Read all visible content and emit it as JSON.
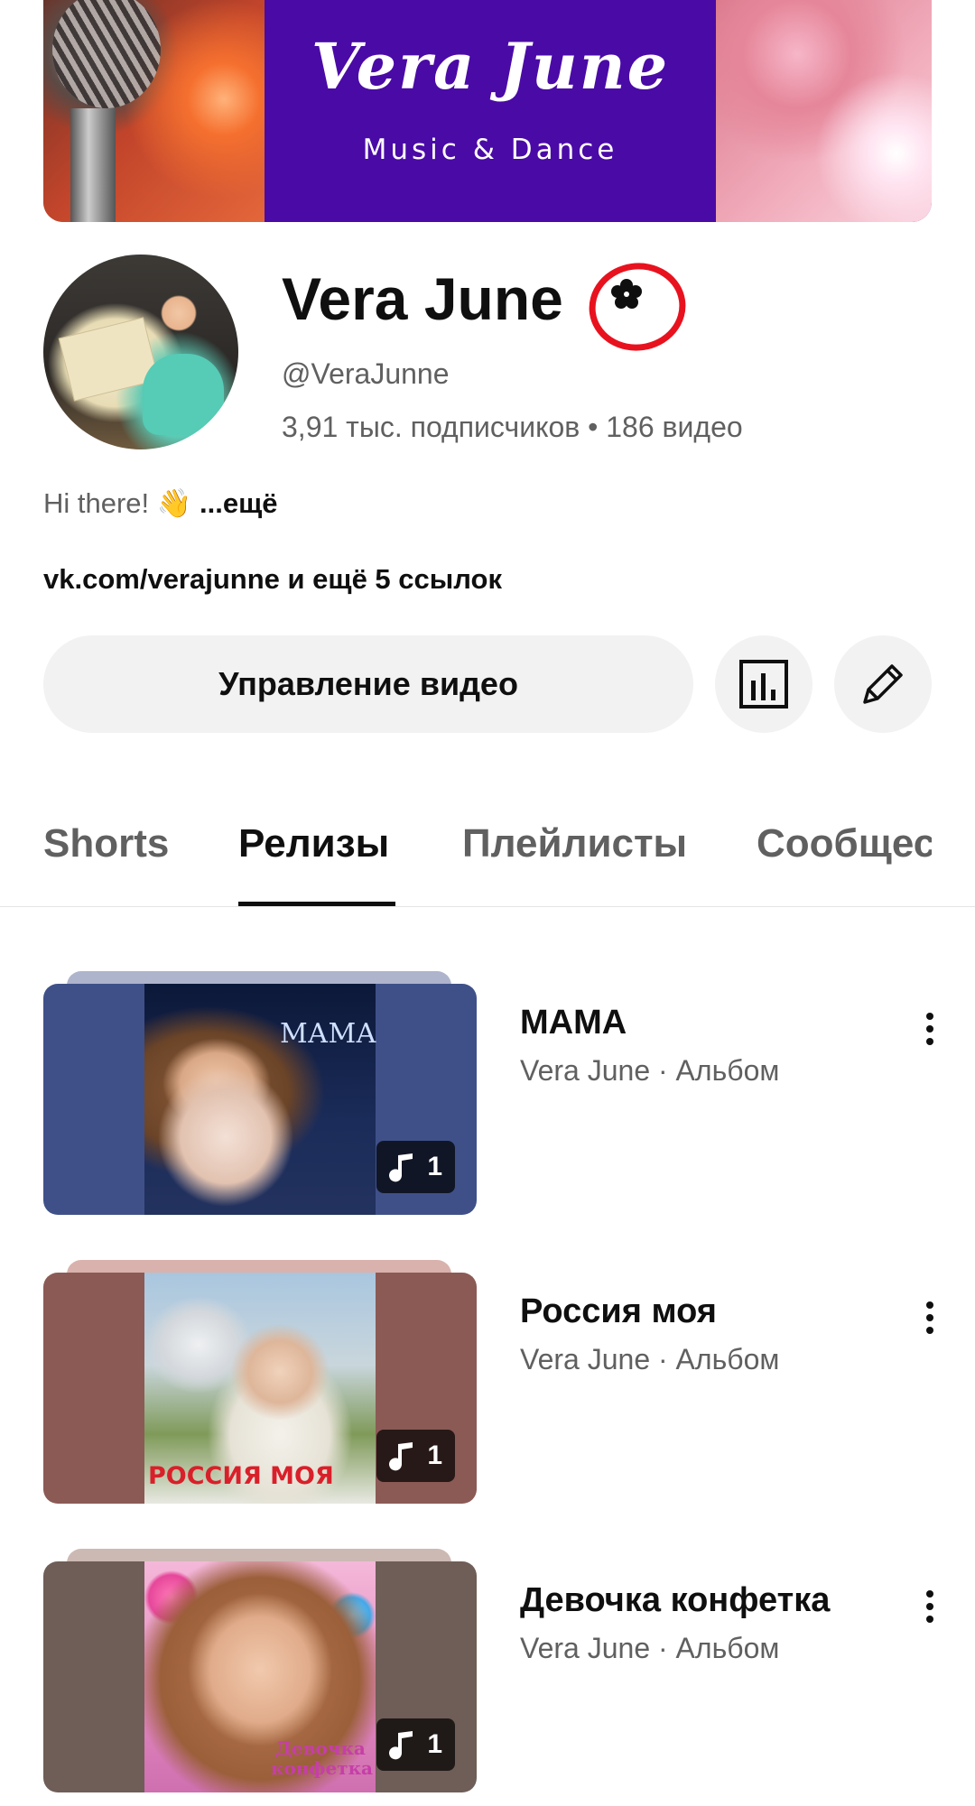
{
  "banner": {
    "title": "Vera June",
    "subtitle": "Music & Dance"
  },
  "channel": {
    "name": "Vera June",
    "handle": "@VeraJunne",
    "stats": "3,91 тыс. подписчиков • 186 видео",
    "about": "Hi there! 👋",
    "about_more": "...ещё",
    "links": "vk.com/verajunne и ещё 5 ссылок"
  },
  "actions": {
    "manage_label": "Управление видео",
    "analytics_icon": "analytics-icon",
    "edit_icon": "pencil-icon"
  },
  "tabs": [
    {
      "label": "Shorts",
      "active": false
    },
    {
      "label": "Релизы",
      "active": true
    },
    {
      "label": "Плейлисты",
      "active": false
    },
    {
      "label": "Сообщес",
      "active": false
    }
  ],
  "releases": [
    {
      "title": "МАМА",
      "meta": "Vera June · Альбом",
      "count": "1",
      "bg": "#3f5089",
      "cover_text": "МАМА"
    },
    {
      "title": "Россия моя",
      "meta": "Vera June · Альбом",
      "count": "1",
      "bg": "#8b5a55",
      "cover_text": "РОССИЯ МОЯ"
    },
    {
      "title": "Девочка конфетка",
      "meta": "Vera June · Альбом",
      "count": "1",
      "bg": "#6f5d57",
      "cover_text": "Девочка конфетка"
    }
  ],
  "colors": {
    "accent_badge_ring": "#e8121e",
    "button_bg": "#f2f2f2",
    "text_primary": "#0f0f0f",
    "text_secondary": "#606060"
  }
}
